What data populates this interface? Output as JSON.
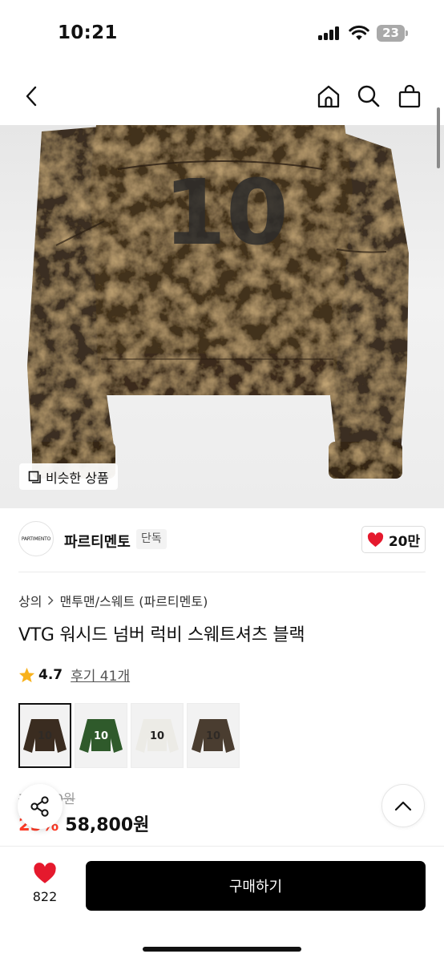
{
  "status_bar": {
    "time": "10:21",
    "battery_level": "23"
  },
  "nav": {
    "icons": [
      "back-icon",
      "home-icon",
      "search-icon",
      "shopping-bag-icon"
    ]
  },
  "product_image": {
    "jersey_number": "10",
    "similar_products_label": "비슷한 상품"
  },
  "brand": {
    "logo_text": "PARTIMENTO",
    "name": "파르티멘토",
    "badge": "단독",
    "like_count": "20만"
  },
  "breadcrumb": {
    "items": [
      "상의",
      "맨투맨/스웨트 (파르티멘토)"
    ]
  },
  "product": {
    "title": "VTG 워시드 넘버 럭비 스웨트셔츠 블랙",
    "rating": "4.7",
    "review_label": "후기 41개",
    "variants": [
      {
        "name": "black",
        "color": "#3a2c20",
        "number": "10",
        "number_color": "#2f2a26",
        "selected": true
      },
      {
        "name": "green",
        "color": "#2f5a2b",
        "number": "10",
        "number_color": "#ffffff",
        "selected": false
      },
      {
        "name": "white",
        "color": "#ecebe6",
        "number": "10",
        "number_color": "#222222",
        "selected": false
      },
      {
        "name": "brown",
        "color": "#4a3d30",
        "number": "10",
        "number_color": "#2f2a26",
        "selected": false
      }
    ]
  },
  "price": {
    "original": "78,400원",
    "discount": "25%",
    "sale": "58,800원"
  },
  "bottom_bar": {
    "wish_count": "822",
    "buy_label": "구매하기"
  },
  "colors": {
    "accent_red": "#ff3c28",
    "heart_red": "#e5192d",
    "star_yellow": "#f8b21c",
    "button_black": "#000000"
  }
}
